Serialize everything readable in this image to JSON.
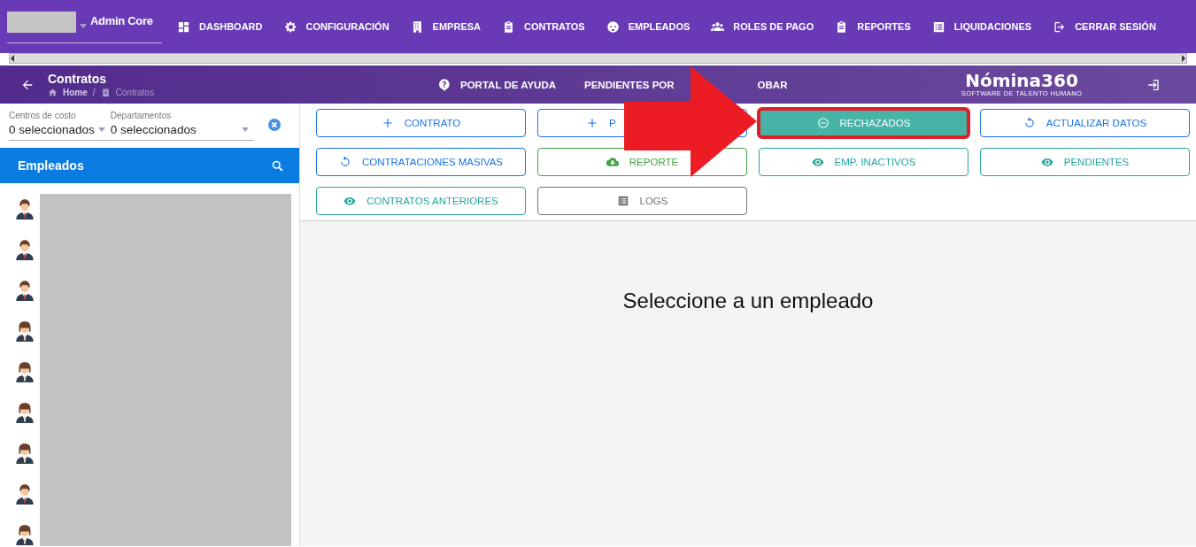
{
  "top_nav": {
    "user": "Admin Core",
    "items": [
      {
        "label": "DASHBOARD"
      },
      {
        "label": "CONFIGURACIÓN"
      },
      {
        "label": "EMPRESA"
      },
      {
        "label": "CONTRATOS"
      },
      {
        "label": "EMPLEADOS"
      },
      {
        "label": "ROLES DE PAGO"
      },
      {
        "label": "REPORTES"
      },
      {
        "label": "LIQUIDACIONES"
      },
      {
        "label": "CERRAR SESIÓN"
      }
    ]
  },
  "header": {
    "title": "Contratos",
    "breadcrumb": [
      "Home",
      "Contratos"
    ],
    "breadcrumb_separator": "/",
    "links": [
      {
        "label": "PORTAL DE AYUDA"
      },
      {
        "label": "PENDIENTES POR",
        "label_tail": "OBAR"
      }
    ],
    "logo": "Nómina360",
    "logo_tagline": "SOFTWARE DE TALENTO HUMANO"
  },
  "filters": [
    {
      "label": "Centros de costo",
      "value": "0 seleccionados"
    },
    {
      "label": "Departamentos",
      "value": "0 seleccionados"
    }
  ],
  "employees_panel": {
    "title": "Empleados",
    "avatars": [
      {
        "kind": "male"
      },
      {
        "kind": "male"
      },
      {
        "kind": "male"
      },
      {
        "kind": "female"
      },
      {
        "kind": "female"
      },
      {
        "kind": "female"
      },
      {
        "kind": "female"
      },
      {
        "kind": "male"
      },
      {
        "kind": "female"
      }
    ]
  },
  "actions": [
    {
      "kind": "add",
      "label": "CONTRATO",
      "filled": false,
      "highlighted": false
    },
    {
      "kind": "add",
      "label": "P",
      "filled": false,
      "highlighted": false
    },
    {
      "kind": "rejected",
      "label": "RECHAZADOS",
      "filled": true,
      "highlighted": true
    },
    {
      "kind": "refresh",
      "label": "ACTUALIZAR DATOS",
      "filled": false,
      "highlighted": false
    },
    {
      "kind": "refresh",
      "label": "CONTRATACIONES MASIVAS",
      "filled": false,
      "highlighted": false
    },
    {
      "kind": "download",
      "label": "REPORTE",
      "filled": false,
      "highlighted": false
    },
    {
      "kind": "view",
      "label": "EMP. INACTIVOS",
      "filled": false,
      "highlighted": false
    },
    {
      "kind": "view",
      "label": "PENDIENTES",
      "filled": false,
      "highlighted": false
    },
    {
      "kind": "view",
      "label": "CONTRATOS ANTERIORES",
      "filled": false,
      "highlighted": false
    },
    {
      "kind": "log",
      "label": "LOGS",
      "filled": false,
      "highlighted": false
    }
  ],
  "empty_message": "Seleccione a un empleado"
}
